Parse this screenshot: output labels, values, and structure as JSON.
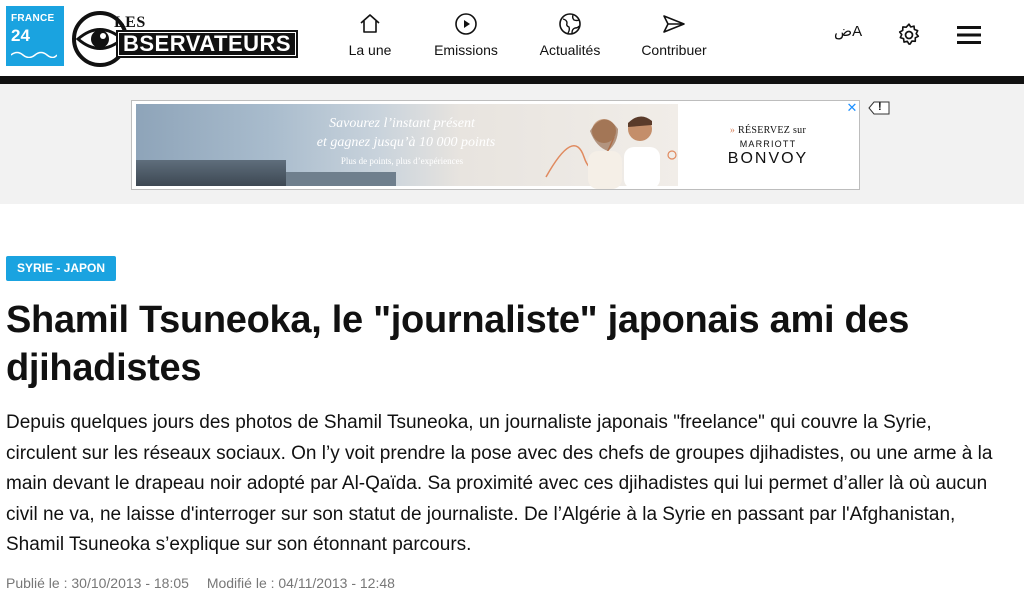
{
  "brand": {
    "france24_line1": "FRANCE",
    "france24_line2": "24",
    "observers_les": "LES",
    "observers_word": "BSERVATEURS"
  },
  "nav": {
    "items": [
      {
        "label": "La une",
        "icon": "home-icon"
      },
      {
        "label": "Emissions",
        "icon": "play-icon"
      },
      {
        "label": "Actualités",
        "icon": "globe-icon"
      },
      {
        "label": "Contribuer",
        "icon": "send-icon"
      }
    ],
    "language_label": "ضA",
    "settings_icon": "gear-icon",
    "menu_icon": "hamburger-icon"
  },
  "ad": {
    "headline_1": "Savourez l’instant présent",
    "headline_2": "et gagnez jusqu’à 10 000 points",
    "subline": "Plus de points, plus d’expériences",
    "cta_arrow": "»",
    "cta": "RÉSERVEZ sur",
    "brand_top": "MARRIOTT",
    "brand_main": "BONVOY",
    "close_symbol": "✕",
    "flag_symbol": "!"
  },
  "article": {
    "tag": "SYRIE - JAPON",
    "title": "Shamil Tsuneoka, le \"journaliste\" japonais ami des djihadistes",
    "lead": "Depuis quelques jours des photos de Shamil Tsuneoka, un journaliste japonais \"freelance\" qui couvre la Syrie, circulent sur les réseaux sociaux. On l’y voit prendre la pose avec des chefs de groupes djihadistes, ou une arme à la main devant le drapeau noir adopté par Al-Qaïda. Sa proximité avec ces djihadistes qui lui permet d’aller là où aucun civil ne va, ne laisse d'interroger sur son statut de journaliste. De l’Algérie à la Syrie en passant par l'Afghanistan, Shamil Tsuneoka s’explique sur son étonnant parcours.",
    "published": "Publié le : 30/10/2013 - 18:05",
    "modified": "Modifié le : 04/11/2013 - 12:48"
  },
  "colors": {
    "accent": "#1aa3e0",
    "header_bar": "#111111",
    "ad_band": "#f2f2f2",
    "meta_text": "#777777"
  }
}
